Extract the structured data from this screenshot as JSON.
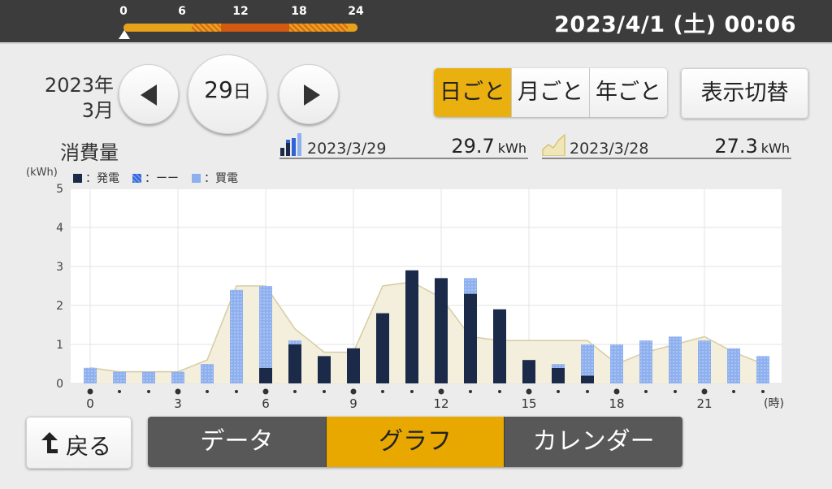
{
  "top_bar": {
    "timeline_labels": [
      "0",
      "6",
      "12",
      "18",
      "24"
    ],
    "datetime": "2023/4/1 (土) 00:06"
  },
  "nav": {
    "year_label": "2023年",
    "month_label": "3月",
    "prev_icon": "triangle-left-icon",
    "next_icon": "triangle-right-icon",
    "day_number": "29",
    "day_unit": "日"
  },
  "period_selector": {
    "options": [
      "日ごと",
      "月ごと",
      "年ごと"
    ],
    "selected": "日ごと"
  },
  "toggle_button_label": "表示切替",
  "consumption_label": "消費量",
  "summary": {
    "current": {
      "date": "2023/3/29",
      "value": "29.7",
      "unit": "kWh",
      "icon": "bar-chart-icon"
    },
    "previous": {
      "date": "2023/3/28",
      "value": "27.3",
      "unit": "kWh",
      "icon": "area-chart-icon"
    }
  },
  "legend": [
    {
      "name": "発電",
      "label": "：発電",
      "color": "#1c2a4a"
    },
    {
      "name": "ーー",
      "label": "：ーー",
      "color": "#2f62d8"
    },
    {
      "name": "買電",
      "label": "：買電",
      "color": "#8fb0ee"
    }
  ],
  "chart_data": {
    "type": "bar",
    "ylabel": "(kWh)",
    "xlabel": "(時)",
    "ylim": [
      0,
      5
    ],
    "yticks": [
      0,
      1,
      2,
      3,
      4,
      5
    ],
    "x": [
      0,
      1,
      2,
      3,
      4,
      5,
      6,
      7,
      8,
      9,
      10,
      11,
      12,
      13,
      14,
      15,
      16,
      17,
      18,
      19,
      20,
      21,
      22,
      23
    ],
    "xtick_labels": {
      "0": "0",
      "3": "3",
      "6": "6",
      "9": "9",
      "12": "12",
      "15": "15",
      "18": "18",
      "21": "21"
    },
    "stacked": true,
    "series": [
      {
        "name": "発電",
        "color": "#1c2a4a",
        "values": [
          0,
          0,
          0,
          0,
          0,
          0,
          0.4,
          1.0,
          0.7,
          0.9,
          1.8,
          2.9,
          2.7,
          2.3,
          1.9,
          0.6,
          0.4,
          0.2,
          0,
          0,
          0,
          0,
          0,
          0
        ]
      },
      {
        "name": "買電",
        "color": "#8fb0ee",
        "values": [
          0.4,
          0.3,
          0.3,
          0.3,
          0.5,
          2.4,
          2.1,
          0.1,
          0,
          0,
          0,
          0,
          0,
          0.4,
          0,
          0,
          0.1,
          0.8,
          1.0,
          1.1,
          1.2,
          1.1,
          0.9,
          0.7
        ]
      }
    ],
    "comparison": {
      "name": "2023/3/28",
      "type": "area",
      "color": "#f3efdc",
      "stroke": "#d6cca4",
      "values": [
        0.4,
        0.3,
        0.3,
        0.3,
        0.6,
        2.5,
        2.5,
        1.4,
        0.8,
        0.8,
        2.5,
        2.6,
        2.2,
        1.2,
        1.1,
        1.1,
        1.1,
        1.1,
        0.5,
        0.8,
        1.0,
        1.2,
        0.8,
        0.5
      ]
    }
  },
  "back_button": {
    "label": "戻る",
    "icon": "return-arrow-icon"
  },
  "tabs": [
    {
      "label": "データ",
      "active": false
    },
    {
      "label": "グラフ",
      "active": true
    },
    {
      "label": "カレンダー",
      "active": false
    }
  ]
}
